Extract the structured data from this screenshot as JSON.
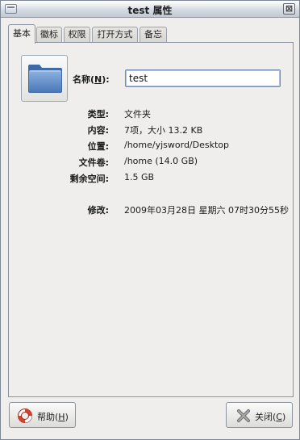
{
  "window": {
    "title": "test 属性",
    "close_symbol": "⊠"
  },
  "tabs": [
    {
      "label": "基本",
      "active": true
    },
    {
      "label": "徽标",
      "active": false
    },
    {
      "label": "权限",
      "active": false
    },
    {
      "label": "打开方式",
      "active": false
    },
    {
      "label": "备忘",
      "active": false
    }
  ],
  "basic": {
    "icon": "folder-icon",
    "name_label": "名称(",
    "name_mnemonic": "N",
    "name_label_end": "):",
    "name_value": "test",
    "rows": [
      {
        "label": "类型:",
        "value": "文件夹"
      },
      {
        "label": "内容:",
        "value": "7项，大小 13.2 KB"
      },
      {
        "label": "位置:",
        "value": "/home/yjsword/Desktop"
      },
      {
        "label": "文件卷:",
        "value": "/home (14.0 GB)"
      },
      {
        "label": "剩余空间:",
        "value": "1.5 GB"
      }
    ],
    "modified_label": "修改:",
    "modified_value": "2009年03月28日 星期六 07时30分55秒"
  },
  "buttons": {
    "help_label": "帮助(",
    "help_mnemonic": "H",
    "help_end": ")",
    "close_label": "关闭(",
    "close_mnemonic": "C",
    "close_end": ")"
  },
  "colors": {
    "accent": "#6f8fb8",
    "folder": "#5b87c6"
  }
}
